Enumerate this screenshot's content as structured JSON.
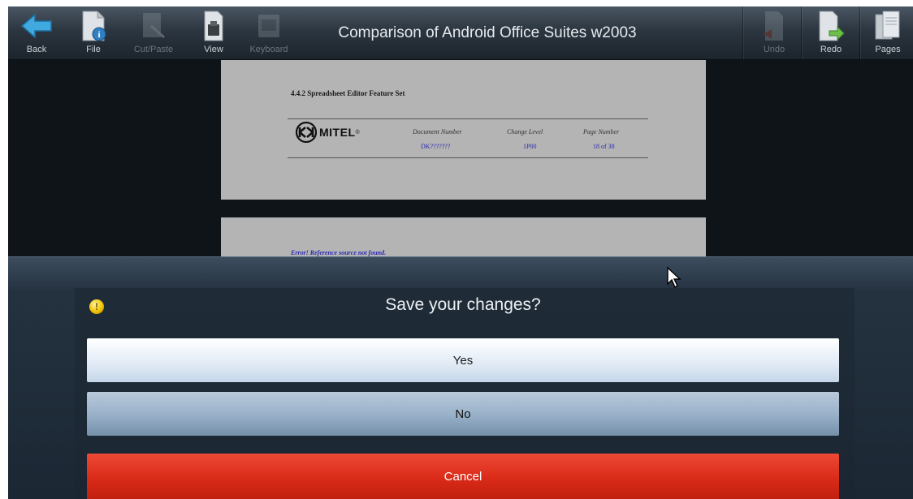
{
  "toolbar": {
    "title": "Comparison of Android Office Suites w2003",
    "buttons": [
      {
        "label": "Back",
        "icon": "back-arrow-icon",
        "enabled": true
      },
      {
        "label": "File",
        "icon": "file-info-icon",
        "enabled": true
      },
      {
        "label": "Cut/Paste",
        "icon": "cut-paste-icon",
        "enabled": false
      },
      {
        "label": "View",
        "icon": "view-icon",
        "enabled": true
      },
      {
        "label": "Keyboard",
        "icon": "keyboard-icon",
        "enabled": false
      },
      {
        "label": "Undo",
        "icon": "undo-icon",
        "enabled": false
      },
      {
        "label": "Redo",
        "icon": "redo-icon",
        "enabled": true
      },
      {
        "label": "Pages",
        "icon": "pages-icon",
        "enabled": true
      }
    ]
  },
  "document": {
    "page1": {
      "heading": "4.4.2   Spreadsheet Editor Feature Set",
      "logo_text": "MITEL",
      "logo_reg": "®",
      "columns": [
        {
          "header": "Document Number",
          "value": "DK???????"
        },
        {
          "header": "Change Level",
          "value": "1P00"
        },
        {
          "header": "Page Number",
          "value": "18 of 38"
        }
      ]
    },
    "page2": {
      "text": "Error! Reference source not found."
    }
  },
  "dialog": {
    "title": "Save your changes?",
    "icon": "warning-icon",
    "buttons": {
      "yes": "Yes",
      "no": "No",
      "cancel": "Cancel"
    }
  },
  "colors": {
    "toolbar_bg": "#2c3640",
    "dialog_bg": "#1b2733",
    "yes_button": "#e3ecf6",
    "no_button": "#9ab2ca",
    "cancel_button": "#d92a18",
    "document_page": "#b4b4b4",
    "link_blue": "#2a2ab0"
  }
}
